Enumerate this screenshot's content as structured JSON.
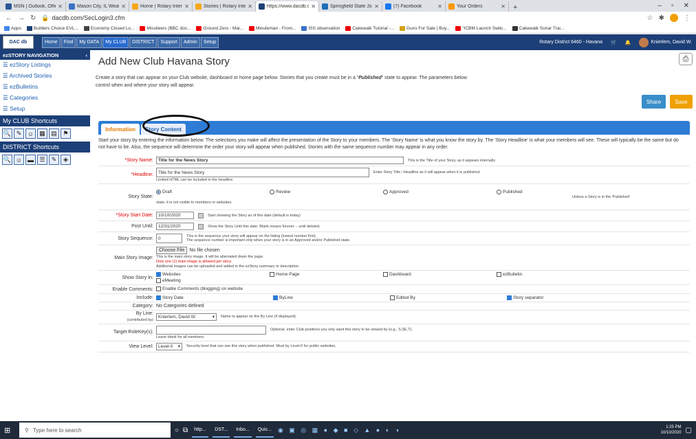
{
  "browser": {
    "tabs": [
      {
        "title": "MSN | Outlook, Office",
        "color": "#2b579a"
      },
      {
        "title": "Mason City, IL Weathe",
        "color": "#3b73c4"
      },
      {
        "title": "Home | Rotary Interna",
        "color": "#f7a81b"
      },
      {
        "title": "Stories | Rotary Intern",
        "color": "#f7a81b"
      },
      {
        "title": "https://www.dacdb.co",
        "color": "#1c3f77"
      },
      {
        "title": "Springfield State Jour",
        "color": "#1e6fb8"
      },
      {
        "title": "(7) Facebook",
        "color": "#1877f2"
      },
      {
        "title": "Your Orders",
        "color": "#ff9900"
      }
    ],
    "url": "dacdb.com/SecLogin3.cfm",
    "bookmarks": [
      "Apps",
      "Builders Choice EVL...",
      "Economy Closed Lo...",
      "Missileers (BBC doc...",
      "Ground Zero - Mai...",
      "Minuteman - From...",
      "ISS observation",
      "Cakewalk Tutorial -...",
      "Guns For Sale | Buy...",
      "\"ICBM Launch Switc...",
      "Cakewalk Sonar Trai..."
    ]
  },
  "topnav": {
    "logo": "DAC db",
    "items": [
      "Home",
      "Find",
      "My DATA",
      "My CLUB",
      "DISTRICT",
      "Support",
      "Admin",
      "Setup"
    ],
    "district": "Rotary District 6460 - Havana",
    "user": "Knierlem, David W."
  },
  "sidebar": {
    "header": "ezSTORY NAVIGATION",
    "items": [
      "ezStory Listings",
      "Archived Stories",
      "ezBulletins",
      "Categories",
      "Setup"
    ],
    "club_shortcuts": "My CLUB Shortcuts",
    "district_shortcuts": "DISTRICT Shortcuts"
  },
  "page": {
    "title": "Add New Club Havana Story",
    "intro_a": "Create a story that can appear on your Club website, dashboard or home page below. Stories that you create must be in a \"",
    "intro_b": "Published",
    "intro_c": "\" state to appear. The parameters below control when and where your story will appear.",
    "share": "Share",
    "save": "Save",
    "tab_info": "Information",
    "tab_content": "Story Content",
    "panel_intro": "Start your story by entering the information below. The selections you make will affect the presentation of the Story to your members. The 'Story Name' is what you know the story by. The 'Story Headline' is what your members will see. These will typically be the same but do not have to be. Also, the sequence will determine the order your story will appear when published. Stories with the same sequence number may appear in any order."
  },
  "form": {
    "story_name_label": "*Story Name:",
    "story_name": "Title for the News Story",
    "story_name_hint": "This is the Title of your Story, as it appears internally",
    "headline_label": "*Headline:",
    "headline": "Title for the News Story",
    "headline_hint": "Enter Story Title / Headline as it will appear when it is published",
    "headline_sub": "Limited HTML can be included in the headline",
    "state_label": "Story State:",
    "states": [
      "Draft",
      "Review",
      "Approved",
      "Published"
    ],
    "state_hint_a": "Unless a Story is in the 'Published'",
    "state_hint_b": "state, it is not visible to members or websites.",
    "start_label": "*Story Start Date:",
    "start_date": "10/10/2020",
    "start_hint": "Start showing the Story as of this date (default is today)",
    "post_label": "Post Until:",
    "post_date": "12/31/2020",
    "post_hint": "Show the Story Until this date. Blank means forever -- until deleted.",
    "seq_label": "Story Sequence:",
    "seq": "0",
    "seq_hint_a": "This is the sequence your story will appear on the listing (lowest number first).",
    "seq_hint_b": "The sequence number is important only when your story is in an Approved and/or Published state.",
    "image_label": "Main Story Image:",
    "choose_file": "Choose File",
    "no_file": "No file chosen",
    "image_hint_a": "This is the main story image. It will be alternated down the page.",
    "image_hint_b": "Only one (1) main image is allowed per story.",
    "image_hint_c": "Additional images can be uploaded and added in the ezStory summary or description.",
    "show_label": "Show Story In:",
    "show_opts": [
      "Websites",
      "Home Page",
      "Dashboard",
      "ezBulletin",
      "eMeeting"
    ],
    "comments_label": "Enable Comments:",
    "comments_opt": "Enable Comments (blogging) on website",
    "include_label": "Include:",
    "include_opts": [
      "Story Date",
      "ByLine",
      "Edited By",
      "Story separator"
    ],
    "category_label": "Category:",
    "category": "No Categories defined",
    "byline_label": "By Line:",
    "byline_sub": "(contributed by)",
    "byline": "Knierlem, David W.",
    "byline_hint": "Name to appear on the By Line (if displayed).",
    "target_label": "Target RoleKey(s):",
    "target_hint": "Optional, enter Club positions you only want this story to be viewed by (e.g., S,SE,T).",
    "target_sub": "Leave blank for all members.",
    "view_label": "View Level:",
    "view": "Level-0",
    "view_hint": "Security level that can see this story when published. Must by Level-0 for public websites."
  },
  "taskbar": {
    "search": "Type here to search",
    "apps": [
      "http...",
      "DST...",
      "Inbo...",
      "Quic..."
    ],
    "time": "1:25 PM",
    "date": "10/10/2020"
  }
}
